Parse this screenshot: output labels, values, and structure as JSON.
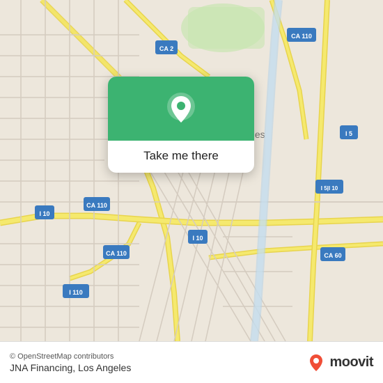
{
  "map": {
    "attribution": "© OpenStreetMap contributors",
    "place_name": "JNA Financing, Los Angeles"
  },
  "card": {
    "label": "Take me there"
  },
  "moovit": {
    "text": "moovit"
  },
  "bottom_bar": {
    "place_label": "JNA Financing, Los Angeles"
  }
}
